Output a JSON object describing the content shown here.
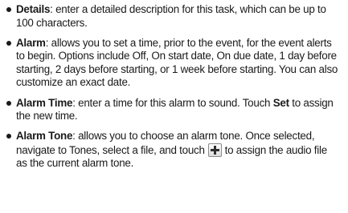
{
  "items": [
    {
      "term": "Details",
      "text": ": enter a detailed description for this task, which can be up to 100 characters."
    },
    {
      "term": "Alarm",
      "text": ": allows you to set a time, prior to the event, for the event alerts to begin. Options include Off, On start date, On due date, 1 day before starting, 2 days before starting, or 1 week before starting. You can also customize an exact date."
    },
    {
      "term": "Alarm Time",
      "text_before": ": enter a time for this alarm to sound. Touch ",
      "bold_word": "Set",
      "text_after": " to assign the new time."
    },
    {
      "term": "Alarm Tone",
      "text_before": ": allows you to choose an alarm tone. Once selected, navigate to Tones, select a file, and touch",
      "icon": "add-icon",
      "text_after": "to assign the audio file as the current alarm tone."
    }
  ]
}
